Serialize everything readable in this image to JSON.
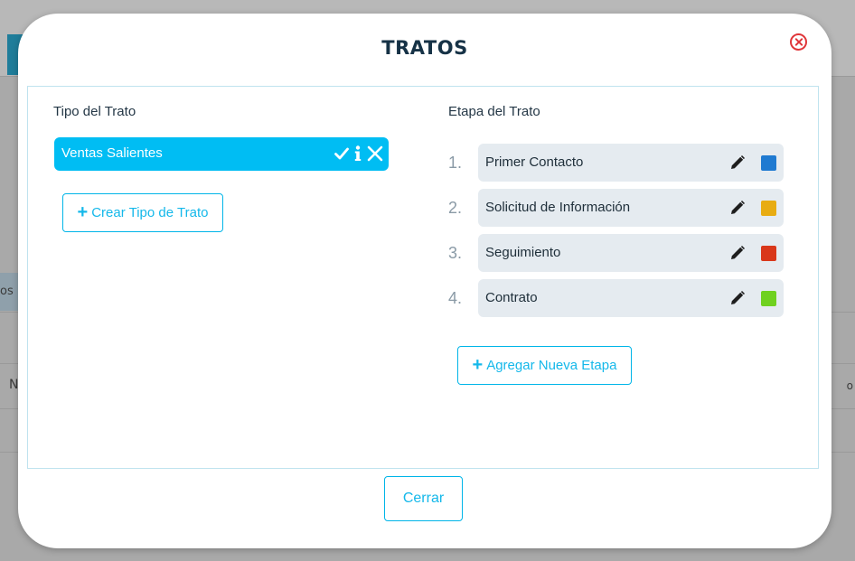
{
  "background": {
    "strip_text": "os In",
    "row_initial": "N",
    "right_text": "o"
  },
  "modal": {
    "title": "TRATOS",
    "close_icon": "close-circle-icon",
    "tipo_section": {
      "label": "Tipo del Trato",
      "items": [
        {
          "label": "Ventas Salientes",
          "icons": [
            "check-icon",
            "info-icon",
            "delete-icon"
          ]
        }
      ],
      "create_button": "Crear Tipo de Trato"
    },
    "etapa_section": {
      "label": "Etapa del Trato",
      "items": [
        {
          "number": "1.",
          "label": "Primer Contacto",
          "color": "#1f7ad1"
        },
        {
          "number": "2.",
          "label": "Solicitud de Información",
          "color": "#e8ac12"
        },
        {
          "number": "3.",
          "label": "Seguimiento",
          "color": "#d9371a"
        },
        {
          "number": "4.",
          "label": "Contrato",
          "color": "#6fd11f"
        }
      ],
      "add_button": "Agregar Nueva Etapa"
    },
    "close_button": "Cerrar"
  },
  "colors": {
    "accent": "#00bdf3",
    "title": "#163246",
    "close_red": "#e0363a"
  }
}
